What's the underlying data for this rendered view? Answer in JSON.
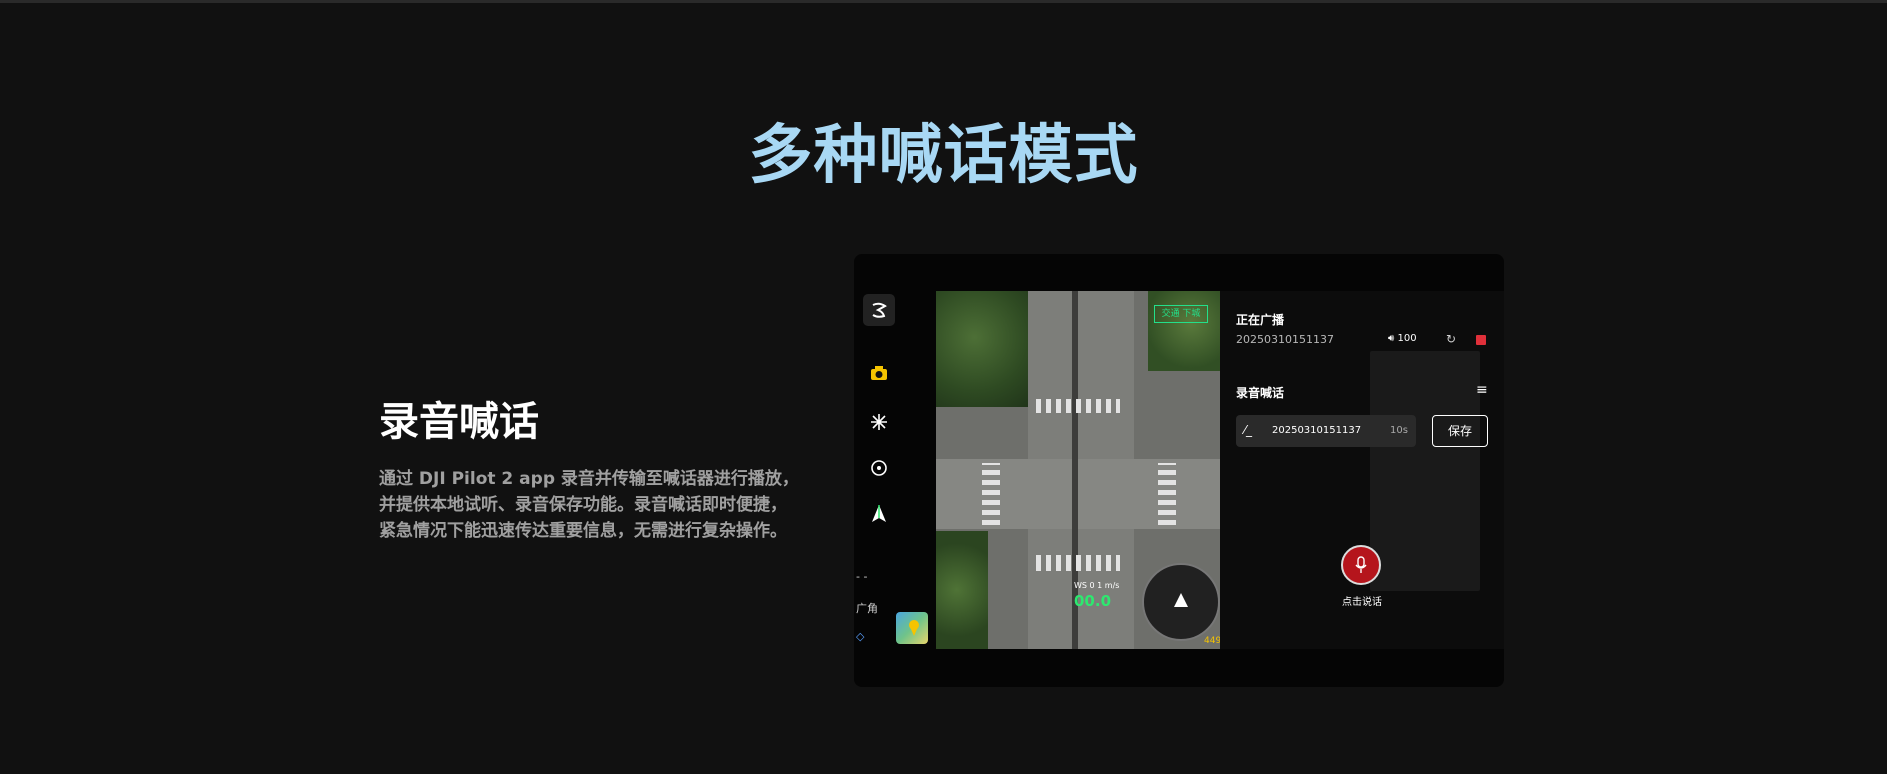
{
  "page": {
    "title": "多种喊话模式"
  },
  "feature": {
    "title": "录音喊话",
    "description": "通过 DJI Pilot 2 app 录音并传输至喊话器进行播放，并提供本地试听、录音保存功能。录音喊话即时便捷，紧急情况下能迅速传达重要信息，无需进行复杂操作。"
  },
  "device": {
    "rail": {
      "lens_label": "广角",
      "dots_label": "- -"
    },
    "video": {
      "sign_text": "交通 下城",
      "ws_text": "WS 0 1 m/s",
      "speed_text": "00.0",
      "alt_text": "449"
    },
    "panel": {
      "broadcasting_label": "正在广播",
      "broadcasting_file": "20250310151137",
      "volume": "100",
      "recording_section_title": "录音喊话",
      "recordings": [
        {
          "name": "20250310151137",
          "duration": "10s"
        }
      ],
      "save_label": "保存",
      "talk_label": "点击说话"
    },
    "colors": {
      "stop": "#e0303a",
      "mic": "#b5151c",
      "accent_title": "#a8d8f4",
      "overlay_green": "#23e08a"
    },
    "icons": [
      "logo-icon",
      "camera-icon",
      "crosshair-icon",
      "target-icon",
      "navigation-icon",
      "map-icon",
      "volume-icon",
      "loop-icon",
      "stop-icon",
      "menu-icon",
      "edit-icon",
      "microphone-icon"
    ]
  }
}
